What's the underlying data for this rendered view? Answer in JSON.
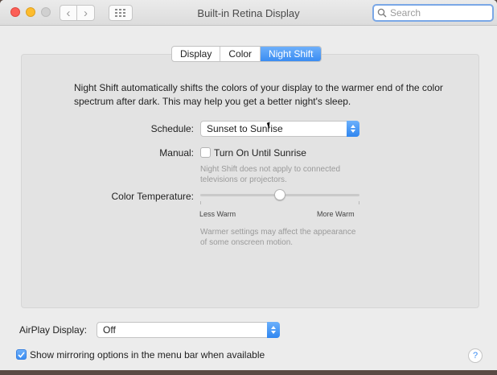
{
  "window": {
    "title": "Built-in Retina Display",
    "search_placeholder": "Search",
    "back_glyph": "‹",
    "forward_glyph": "›"
  },
  "tabs": [
    {
      "label": "Display",
      "active": false
    },
    {
      "label": "Color",
      "active": false
    },
    {
      "label": "Night Shift",
      "active": true
    }
  ],
  "night_shift": {
    "description": "Night Shift automatically shifts the colors of your display to the warmer end of the color spectrum after dark. This may help you get a better night's sleep.",
    "schedule_label": "Schedule:",
    "schedule_value": "Sunset to Sunrise",
    "manual_label": "Manual:",
    "manual_checkbox_label": "Turn On Until Sunrise",
    "manual_checked": false,
    "manual_note": "Night Shift does not apply to connected televisions or projectors.",
    "color_temp_label": "Color Temperature:",
    "color_temp_level": 0.5,
    "less_warm_label": "Less Warm",
    "more_warm_label": "More Warm",
    "warmth_note": "Warmer settings may affect the appearance of some onscreen motion."
  },
  "footer": {
    "airplay_label": "AirPlay Display:",
    "airplay_value": "Off",
    "mirroring_label": "Show mirroring options in the menu bar when available",
    "mirroring_checked": true,
    "help_glyph": "?"
  },
  "colors": {
    "accent": "#3a8cf2",
    "close": "#fc5f57",
    "minimize": "#fdbc2e"
  }
}
